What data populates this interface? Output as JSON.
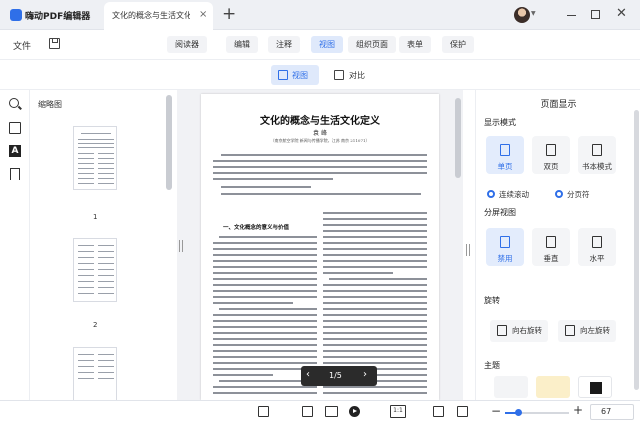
{
  "app": {
    "title": "嗨动PDF编辑器",
    "accent": "#2f6fe8"
  },
  "tab": {
    "title": "文化的概念与生活文化...",
    "close": "×"
  },
  "new_tab": "+",
  "menu": {
    "file": "文件",
    "tabs": [
      "阅读器",
      "编辑",
      "注释",
      "视图",
      "组织页面",
      "表单",
      "保护"
    ],
    "active_tab": "视图"
  },
  "subtoolbar": {
    "view": "视图",
    "compare": "对比"
  },
  "thumbnails": {
    "title": "缩略图",
    "pages": [
      "1",
      "2"
    ]
  },
  "document": {
    "heading": "文化的概念与生活文化定义",
    "author": "袁  峰",
    "affiliation": "（南京航空学院 新闻与传播学院，江苏 南京 211071）",
    "section": "一、文化概念的意义与价值"
  },
  "page_nav": {
    "prev": "‹",
    "page": "1/5",
    "next": "›"
  },
  "right_panel": {
    "title": "页面显示",
    "display_mode": {
      "label": "显示模式",
      "options": [
        "单页",
        "双页",
        "书本模式"
      ],
      "selected": "单页",
      "scroll_label": "连续滚动",
      "split_label": "分页符"
    },
    "split_view": {
      "label": "分屏视图",
      "options": [
        "禁用",
        "垂直",
        "水平"
      ],
      "selected": "禁用"
    },
    "rotate": {
      "label": "旋转",
      "right": "向右旋转",
      "left": "向左旋转"
    },
    "theme": {
      "label": "主题",
      "colors": [
        "#f3f4f6",
        "#fbefc9",
        "#1a1a1a"
      ]
    }
  },
  "bottombar": {
    "actual_size": "1:1",
    "zoom_out": "−",
    "zoom_in": "+",
    "zoom_value": "67",
    "zoom_fraction": 0.2
  }
}
